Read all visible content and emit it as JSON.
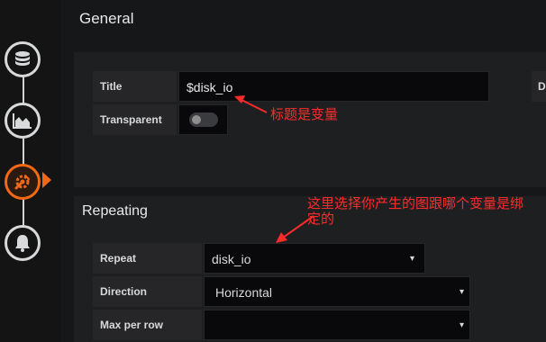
{
  "sidebar": {
    "steps": [
      {
        "icon": "database-icon"
      },
      {
        "icon": "area-chart-icon"
      },
      {
        "icon": "wrench-gear-icon",
        "active": true
      },
      {
        "icon": "bell-icon"
      }
    ],
    "accent_color": "#f26915"
  },
  "general": {
    "heading": "General",
    "title_label": "Title",
    "title_value": "$disk_io",
    "description_label_partial": "De",
    "transparent_label": "Transparent",
    "transparent_on": false
  },
  "repeating": {
    "heading": "Repeating",
    "repeat_label": "Repeat",
    "repeat_value": "disk_io",
    "direction_label": "Direction",
    "direction_value": "Horizontal",
    "max_per_row_label": "Max per row",
    "max_per_row_value": ""
  },
  "annotations": {
    "title_note": "标题是变量",
    "repeat_note_line1": "这里选择你产生的图跟哪个变量是绑",
    "repeat_note_line2": "定的",
    "color": "#ff2b2b"
  }
}
